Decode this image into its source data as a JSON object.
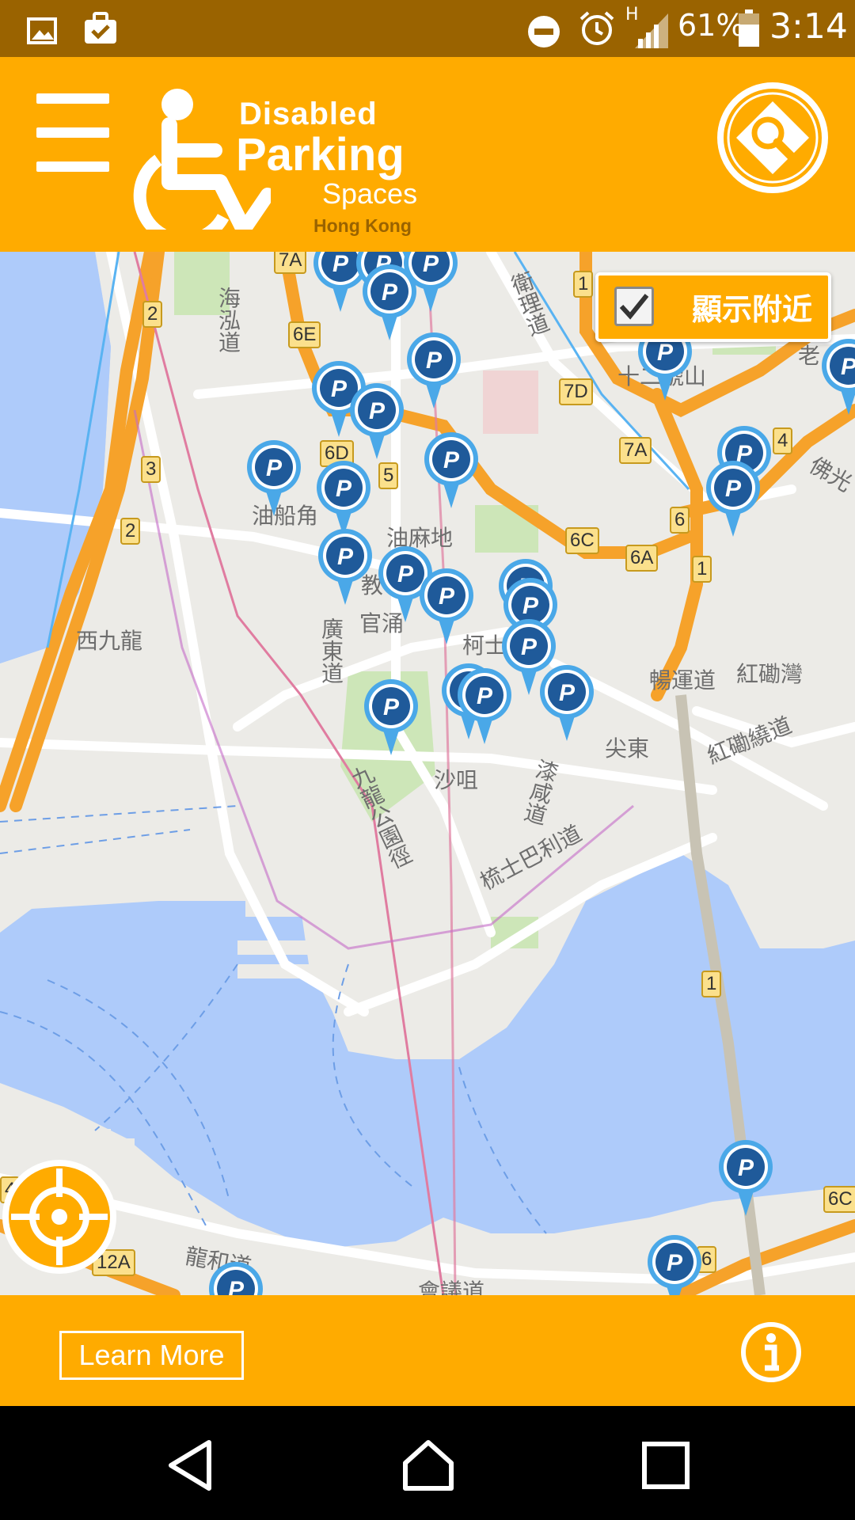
{
  "status_bar": {
    "network_label": "H",
    "battery_percent": "61%",
    "time": "3:14",
    "icons": [
      "image-icon",
      "briefcase-check-icon",
      "do-not-disturb-icon",
      "alarm-icon",
      "signal-icon",
      "battery-icon"
    ]
  },
  "header": {
    "logo": {
      "line1": "Disabled",
      "line2": "Parking",
      "line3": "Spaces",
      "line4": "Hong Kong"
    },
    "menu_icon": "hamburger-menu-icon",
    "search_icon": "map-search-icon"
  },
  "map": {
    "nearby_toggle": {
      "label": "顯示附近",
      "checked": true
    },
    "labels": {
      "hoi_wang_road": "海泓道",
      "canal_road": "衛理道",
      "twelve_hill": "十二號山",
      "yau_ma_tei": "油麻地",
      "west_kowloon": "西九龍",
      "canton_road": "廣東道",
      "kowloon_park_drive": "九龍公園徑",
      "salisbury_road": "梳士巴利道",
      "hung_hom_bay": "紅磡灣",
      "hung_hom_bypass": "紅磡繞道",
      "cheong_wan_road": "暢運道",
      "tsim_east": "尖東",
      "yau_ma_tei_typhoon": "油船角",
      "kwun_chung": "官涌",
      "austin": "柯士甸",
      "tsim_sha": "沙咀",
      "chatham_road": "漆咸道",
      "lung_wo_road": "龍和道",
      "convention_road": "會議道",
      "kwong_ming": "佛光",
      "lo": "老",
      "teach": "教"
    },
    "route_shields": [
      "7A",
      "6E",
      "2",
      "6D",
      "5",
      "3",
      "2",
      "1",
      "7D",
      "7A",
      "4",
      "6",
      "6C",
      "6A",
      "1",
      "1",
      "4",
      "12A",
      "6",
      "6C"
    ],
    "marker_letter": "P",
    "locate_icon": "crosshair-locate-icon"
  },
  "footer": {
    "learn_more": "Learn More",
    "info_icon": "info-icon"
  },
  "nav_bar": {
    "back_icon": "back-triangle-icon",
    "home_icon": "home-icon",
    "recents_icon": "recents-square-icon"
  }
}
